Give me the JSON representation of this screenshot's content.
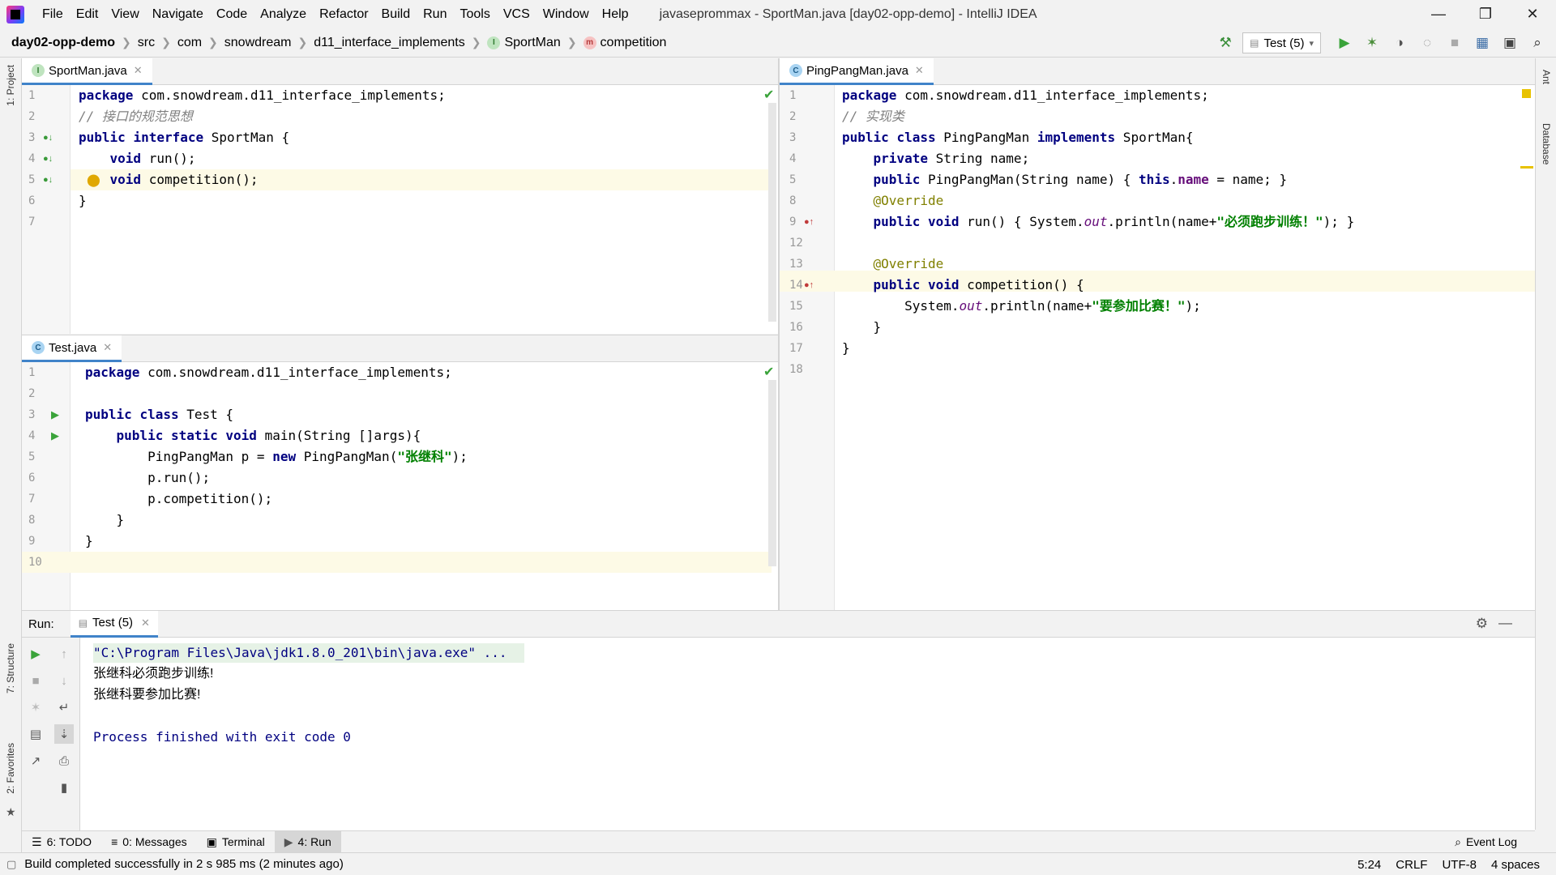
{
  "menubar": {
    "items": [
      "File",
      "Edit",
      "View",
      "Navigate",
      "Code",
      "Analyze",
      "Refactor",
      "Build",
      "Run",
      "Tools",
      "VCS",
      "Window",
      "Help"
    ],
    "title": "javaseprommax - SportMan.java [day02-opp-demo] - IntelliJ IDEA"
  },
  "breadcrumb": {
    "project": "day02-opp-demo",
    "parts": [
      "src",
      "com",
      "snowdream",
      "d11_interface_implements"
    ],
    "class": "SportMan",
    "member": "competition"
  },
  "toolbar": {
    "run_config": "Test (5)"
  },
  "side_tabs": {
    "project": "1: Project",
    "structure": "7: Structure",
    "favorites": "2: Favorites",
    "ant": "Ant",
    "database": "Database"
  },
  "editors": {
    "sportman": {
      "tab": "SportMan.java",
      "lines": [
        {
          "n": "1",
          "text": "package com.snowdream.d11_interface_implements;"
        },
        {
          "n": "2",
          "text": "// 接口的规范思想"
        },
        {
          "n": "3",
          "text": "public interface SportMan {"
        },
        {
          "n": "4",
          "text": "    void run();"
        },
        {
          "n": "5",
          "text": "    void competition();"
        },
        {
          "n": "6",
          "text": "}"
        },
        {
          "n": "7",
          "text": ""
        }
      ]
    },
    "test": {
      "tab": "Test.java",
      "lines": [
        {
          "n": "1",
          "text": "package com.snowdream.d11_interface_implements;"
        },
        {
          "n": "2",
          "text": ""
        },
        {
          "n": "3",
          "text": "public class Test {"
        },
        {
          "n": "4",
          "text": "    public static void main(String []args){"
        },
        {
          "n": "5",
          "text": "        PingPangMan p = new PingPangMan(\"张继科\");"
        },
        {
          "n": "6",
          "text": "        p.run();"
        },
        {
          "n": "7",
          "text": "        p.competition();"
        },
        {
          "n": "8",
          "text": "    }"
        },
        {
          "n": "9",
          "text": "}"
        },
        {
          "n": "10",
          "text": ""
        }
      ]
    },
    "pingpang": {
      "tab": "PingPangMan.java",
      "lines": [
        {
          "n": "1",
          "text": "package com.snowdream.d11_interface_implements;"
        },
        {
          "n": "2",
          "text": "// 实现类"
        },
        {
          "n": "3",
          "text": "public class PingPangMan implements SportMan{"
        },
        {
          "n": "4",
          "text": "    private String name;"
        },
        {
          "n": "5",
          "text": "    public PingPangMan(String name) { this.name = name; }"
        },
        {
          "n": "8",
          "text": "    @Override"
        },
        {
          "n": "9",
          "text": "    public void run() { System.out.println(name+\"必须跑步训练！\"); }"
        },
        {
          "n": "12",
          "text": ""
        },
        {
          "n": "13",
          "text": "    @Override"
        },
        {
          "n": "14",
          "text": "    public void competition() {"
        },
        {
          "n": "15",
          "text": "        System.out.println(name+\"要参加比赛！\");"
        },
        {
          "n": "16",
          "text": "    }"
        },
        {
          "n": "17",
          "text": "}"
        },
        {
          "n": "18",
          "text": ""
        }
      ]
    }
  },
  "run_panel": {
    "label": "Run:",
    "tab": "Test (5)",
    "console": [
      "\"C:\\Program Files\\Java\\jdk1.8.0_201\\bin\\java.exe\" ...",
      "张继科必须跑步训练!",
      "张继科要参加比赛!",
      "",
      "Process finished with exit code 0"
    ]
  },
  "tool_tabs": {
    "todo": "6: TODO",
    "messages": "0: Messages",
    "terminal": "Terminal",
    "run": "4: Run",
    "event_log": "Event Log"
  },
  "statusbar": {
    "message": "Build completed successfully in 2 s 985 ms (2 minutes ago)",
    "position": "5:24",
    "line_sep": "CRLF",
    "encoding": "UTF-8",
    "indent": "4 spaces"
  }
}
